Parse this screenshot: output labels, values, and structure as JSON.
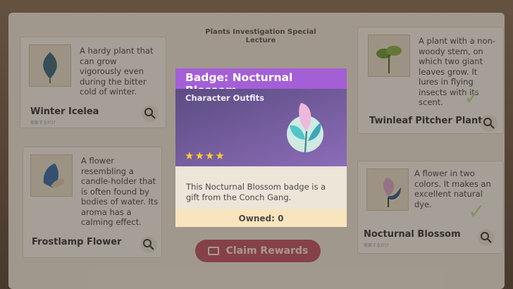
{
  "lecture": {
    "title_line1": "Plants Investigation Special",
    "title_line2": "Lecture"
  },
  "plants": [
    {
      "name": "Winter Icelea",
      "description": "A hardy plant that can grow vigorously even during the bitter cold of winter.",
      "status": "探索するだけ"
    },
    {
      "name": "Twinleaf Pitcher Plant",
      "description": "A plant with a non-woody stem, on which two giant leaves grow. It lures in flying insects with its scent."
    },
    {
      "name": "Frostlamp Flower",
      "description": "A flower resembling a candle-holder that is often found by bodies of water. Its aroma has a calming effect."
    },
    {
      "name": "Nocturnal Blossom",
      "description": "A flower in two colors. It makes an excellent natural dye.",
      "status": "探索するだけ"
    }
  ],
  "claim_button": "Claim Rewards",
  "popup": {
    "title": "Badge: Nocturnal Blossom",
    "category": "Character Outfits",
    "rarity_stars": 4,
    "stars_text": "★★★★",
    "description": "This Nocturnal Blossom badge is a gift from the Conch Gang.",
    "owned": "Owned: 0"
  },
  "colors": {
    "title_bar": "#a45fd6",
    "card_bg": "#5b4c82",
    "owned_bar": "#f8e4bd",
    "claim": "#bf5763"
  }
}
